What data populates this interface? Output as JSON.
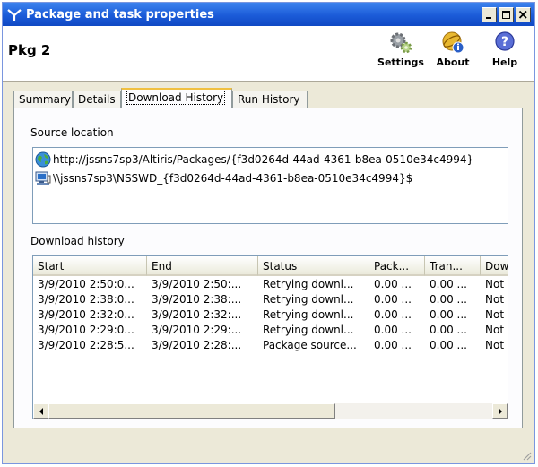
{
  "window": {
    "title": "Package and task properties"
  },
  "header": {
    "package_name": "Pkg 2",
    "toolbar": [
      {
        "label": "Settings",
        "icon": "settings-gears-icon"
      },
      {
        "label": "About",
        "icon": "about-info-icon"
      },
      {
        "label": "Help",
        "icon": "help-question-icon"
      }
    ]
  },
  "tabs": [
    {
      "label": "Summary",
      "active": false
    },
    {
      "label": "Details",
      "active": false
    },
    {
      "label": "Download History",
      "active": true
    },
    {
      "label": "Run History",
      "active": false
    }
  ],
  "source": {
    "label": "Source location",
    "entries": [
      {
        "icon": "globe-icon",
        "text": "http://jssns7sp3/Altiris/Packages/{f3d0264d-44ad-4361-b8ea-0510e34c4994}"
      },
      {
        "icon": "network-share-icon",
        "text": "\\\\jssns7sp3\\NSSWD_{f3d0264d-44ad-4361-b8ea-0510e34c4994}$"
      }
    ]
  },
  "history": {
    "label": "Download history",
    "columns": [
      "Start",
      "End",
      "Status",
      "Pack...",
      "Tran...",
      "Dow"
    ],
    "rows": [
      [
        "3/9/2010 2:50:0...",
        "3/9/2010 2:50:...",
        "Retrying downl...",
        "0.00 ...",
        "0.00 ...",
        "Not"
      ],
      [
        "3/9/2010 2:38:0...",
        "3/9/2010 2:38:...",
        "Retrying downl...",
        "0.00 ...",
        "0.00 ...",
        "Not"
      ],
      [
        "3/9/2010 2:32:0...",
        "3/9/2010 2:32:...",
        "Retrying downl...",
        "0.00 ...",
        "0.00 ...",
        "Not"
      ],
      [
        "3/9/2010 2:29:0...",
        "3/9/2010 2:29:...",
        "Retrying downl...",
        "0.00 ...",
        "0.00 ...",
        "Not"
      ],
      [
        "3/9/2010 2:28:5...",
        "3/9/2010 2:28:...",
        "Package source...",
        "0.00 ...",
        "0.00 ...",
        "Not"
      ]
    ]
  },
  "colors": {
    "titlebar": "#1b5bd8",
    "accent_tab": "#f0c040"
  }
}
